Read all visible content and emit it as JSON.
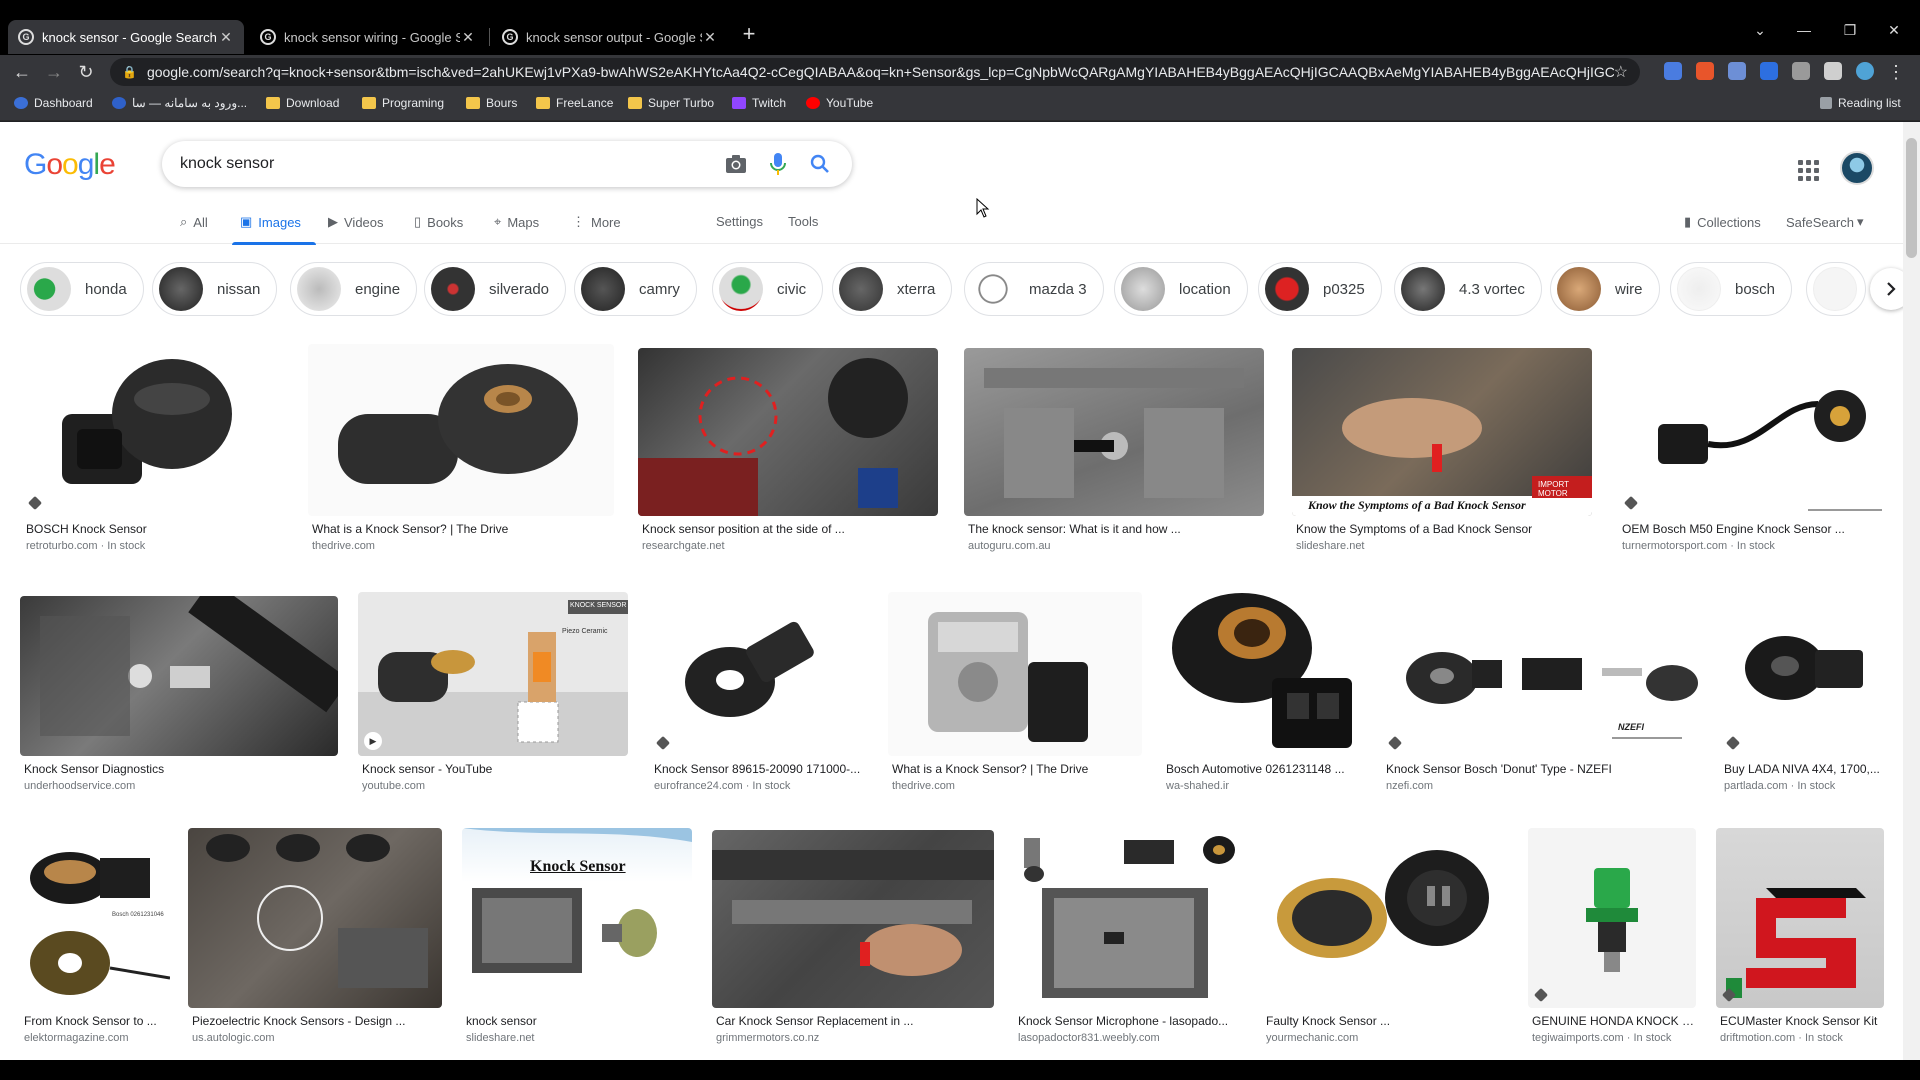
{
  "browser": {
    "tabs": [
      {
        "title": "knock sensor - Google Search",
        "active": true
      },
      {
        "title": "knock sensor wiring - Google Se",
        "active": false
      },
      {
        "title": "knock sensor output - Google Se",
        "active": false
      }
    ],
    "url": "google.com/search?q=knock+sensor&tbm=isch&ved=2ahUKEwj1vPXa9-bwAhWS2eAKHYtcAa4Q2-cCegQIABAA&oq=kn+Sensor&gs_lcp=CgNpbWcQARgAMgYIABAHEB4yBggAEAcQHjIGCAAQBxAeMgYIABAHEB4yBggAEAcQHjIGCAAQ...",
    "bookmarks": [
      "Dashboard",
      "ورود به سامانه — سا...",
      "Download",
      "Programing",
      "Bours",
      "FreeLance",
      "Super Turbo",
      "Twitch",
      "YouTube"
    ],
    "reading_list": "Reading list"
  },
  "google": {
    "logo": "Google",
    "query": "knock sensor",
    "nav": [
      "All",
      "Images",
      "Videos",
      "Books",
      "Maps",
      "More"
    ],
    "settings": "Settings",
    "tools": "Tools",
    "collections": "Collections",
    "safesearch": "SafeSearch"
  },
  "chips": [
    "honda",
    "nissan",
    "engine",
    "silverado",
    "camry",
    "civic",
    "xterra",
    "mazda 3",
    "location",
    "p0325",
    "4.3 vortec",
    "wire",
    "bosch"
  ],
  "results": [
    {
      "caption": "BOSCH Knock Sensor",
      "source": "retroturbo.com · In stock",
      "tone": "#2b2b2b"
    },
    {
      "caption": "What is a Knock Sensor? | The Drive",
      "source": "thedrive.com",
      "tone": "#333333"
    },
    {
      "caption": "Knock sensor position at the side of ...",
      "source": "researchgate.net",
      "tone": "#4a4a4a"
    },
    {
      "caption": "The knock sensor: What is it and how ...",
      "source": "autoguru.com.au",
      "tone": "#8a8a8a"
    },
    {
      "caption": "Know the Symptoms of a Bad Knock Sensor",
      "source": "slideshare.net",
      "tone": "#6b5a4e"
    },
    {
      "caption": "OEM Bosch M50 Engine Knock Sensor ...",
      "source": "turnermotorsport.com · In stock",
      "tone": "#222222"
    },
    {
      "caption": "Knock Sensor Diagnostics",
      "source": "underhoodservice.com",
      "tone": "#5b5b5b"
    },
    {
      "caption": "Knock sensor - YouTube",
      "source": "youtube.com",
      "tone": "#c9c9c9"
    },
    {
      "caption": "Knock Sensor 89615-20090 171000-...",
      "source": "eurofrance24.com · In stock",
      "tone": "#2e2e2e"
    },
    {
      "caption": "What is a Knock Sensor? | The Drive",
      "source": "thedrive.com",
      "tone": "#9a9a9a"
    },
    {
      "caption": "Bosch Automotive 0261231148 ...",
      "source": "wa-shahed.ir",
      "tone": "#1e1e1e"
    },
    {
      "caption": "Knock Sensor Bosch 'Donut' Type - NZEFI",
      "source": "nzefi.com",
      "tone": "#3a3a3a"
    },
    {
      "caption": "Buy LADA NIVA 4X4, 1700,...",
      "source": "partlada.com · In stock",
      "tone": "#252525"
    },
    {
      "caption": "From Knock Sensor to ...",
      "source": "elektormagazine.com",
      "tone": "#3d3321"
    },
    {
      "caption": "Piezoelectric Knock Sensors - Design ...",
      "source": "us.autologic.com",
      "tone": "#4f4a45"
    },
    {
      "caption": "knock sensor",
      "source": "slideshare.net",
      "tone": "#e8f1f8"
    },
    {
      "caption": "Car Knock Sensor Replacement in ...",
      "source": "grimmermotors.co.nz",
      "tone": "#555555"
    },
    {
      "caption": "Knock Sensor Microphone - lasopado...",
      "source": "lasopadoctor831.weebly.com",
      "tone": "#777777"
    },
    {
      "caption": "Faulty Knock Sensor ...",
      "source": "yourmechanic.com",
      "tone": "#2a2418"
    },
    {
      "caption": "GENUINE HONDA KNOCK S...",
      "source": "tegiwaimports.com · In stock",
      "tone": "#f4f4f4"
    },
    {
      "caption": "ECUMaster Knock Sensor Kit",
      "source": "driftmotion.com · In stock",
      "tone": "#d0d0d0"
    }
  ],
  "overlay_texts": {
    "slideshare_banner": "Know the Symptoms of a Bad Knock Sensor",
    "slideshare_title": "Knock Sensor",
    "youtube_label": "KNOCK SENSOR",
    "piezo_label": "Piezo Ceramic",
    "bosch_label": "Bosch 0261231046",
    "nzefi_logo": "NZEFI",
    "import_label": "IMPORT MOTOR"
  },
  "colors": {
    "google_blue": "#4285F4",
    "google_red": "#EA4335",
    "google_yellow": "#FBBC05",
    "google_green": "#34A853",
    "active_tab": "#1a73e8"
  }
}
